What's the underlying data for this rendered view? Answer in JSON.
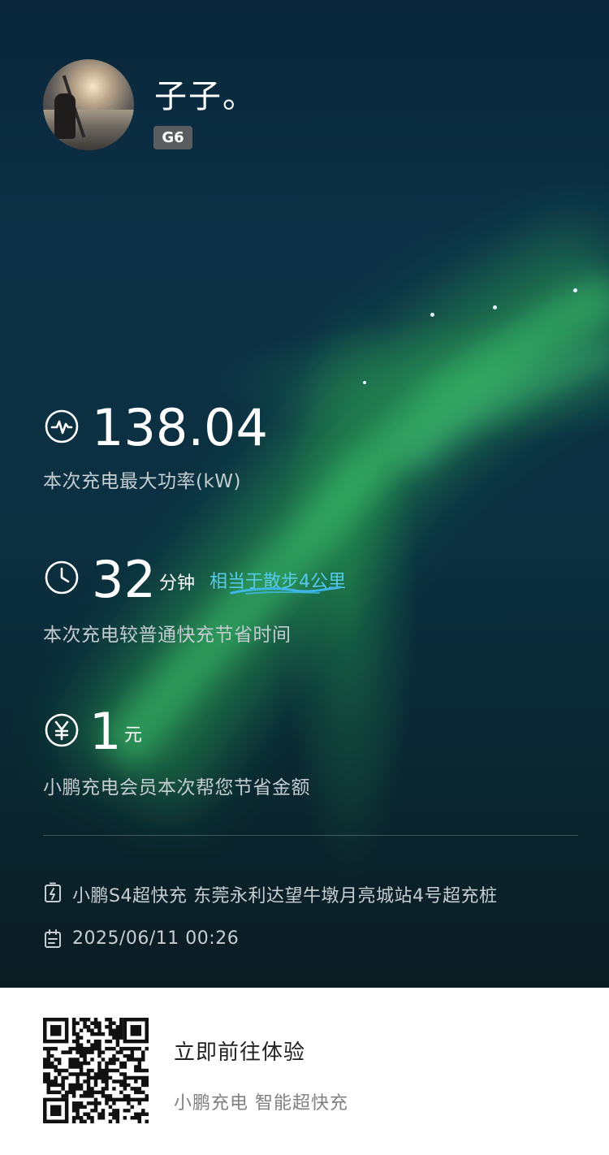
{
  "profile": {
    "username": "子子。",
    "vehicle_badge": "G6"
  },
  "stats": {
    "max_power": {
      "value": "138.04",
      "label": "本次充电最大功率(kW)",
      "icon": "activity-icon"
    },
    "time_saved": {
      "value": "32",
      "unit": "分钟",
      "equivalent": "相当于散步4公里",
      "label": "本次充电较普通快充节省时间",
      "icon": "clock-icon"
    },
    "money_saved": {
      "value": "1",
      "unit": "元",
      "label": "小鹏充电会员本次帮您节省金额",
      "icon": "yen-icon"
    }
  },
  "station": {
    "name": "小鹏S4超快充 东莞永利达望牛墩月亮城站4号超充桩",
    "icon": "charging-station-icon"
  },
  "session": {
    "datetime": "2025/06/11 00:26",
    "icon": "calendar-icon"
  },
  "footer": {
    "cta": "立即前往体验",
    "slogan": "小鹏充电 智能超快充",
    "qr_icon": "qr-code-icon"
  },
  "colors": {
    "background": "#0b3040",
    "accent": "#55cbea",
    "text_secondary": "#c3ccd0",
    "aurora": "#2fae5c"
  }
}
